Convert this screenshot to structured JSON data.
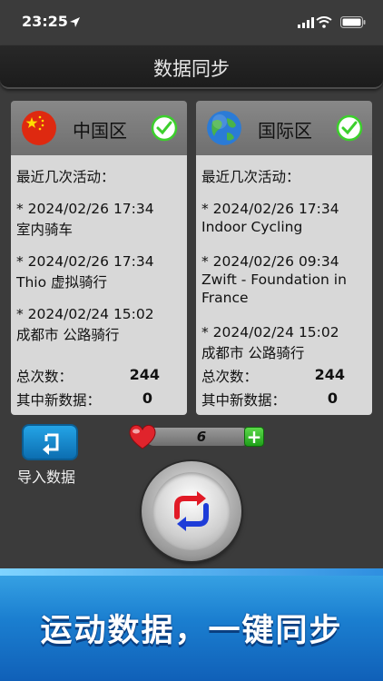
{
  "status_bar": {
    "time": "23:25"
  },
  "header": {
    "title": "数据同步"
  },
  "panels": [
    {
      "region": "中国区",
      "flag_icon": "china-flag-icon",
      "recent_label": "最近几次活动：",
      "activities": [
        {
          "datetime": "* 2024/02/26 17:34",
          "name": "室内骑车"
        },
        {
          "datetime": "* 2024/02/26 17:34",
          "name": "Thio 虚拟骑行"
        },
        {
          "datetime": "* 2024/02/24 15:02",
          "name": "成都市 公路骑行"
        }
      ],
      "total_label": "总次数：",
      "total_value": "244",
      "new_label": "其中新数据：",
      "new_value": "0"
    },
    {
      "region": "国际区",
      "flag_icon": "globe-icon",
      "recent_label": "最近几次活动：",
      "activities": [
        {
          "datetime": "* 2024/02/26 17:34",
          "name": "Indoor Cycling"
        },
        {
          "datetime": "* 2024/02/26 09:34",
          "name": "Zwift - Foundation in",
          "name2": "France"
        },
        {
          "datetime": "* 2024/02/24 15:02",
          "name": "成都市 公路骑行"
        }
      ],
      "total_label": "总次数：",
      "total_value": "244",
      "new_label": "其中新数据：",
      "new_value": "0"
    }
  ],
  "import": {
    "label": "导入数据"
  },
  "hearts": {
    "count": "6"
  },
  "banner": {
    "text": "运动数据，一键同步"
  },
  "colors": {
    "check": "#3ccf2c",
    "accent_blue": "#1b7fd0",
    "heart": "#e0242c"
  }
}
